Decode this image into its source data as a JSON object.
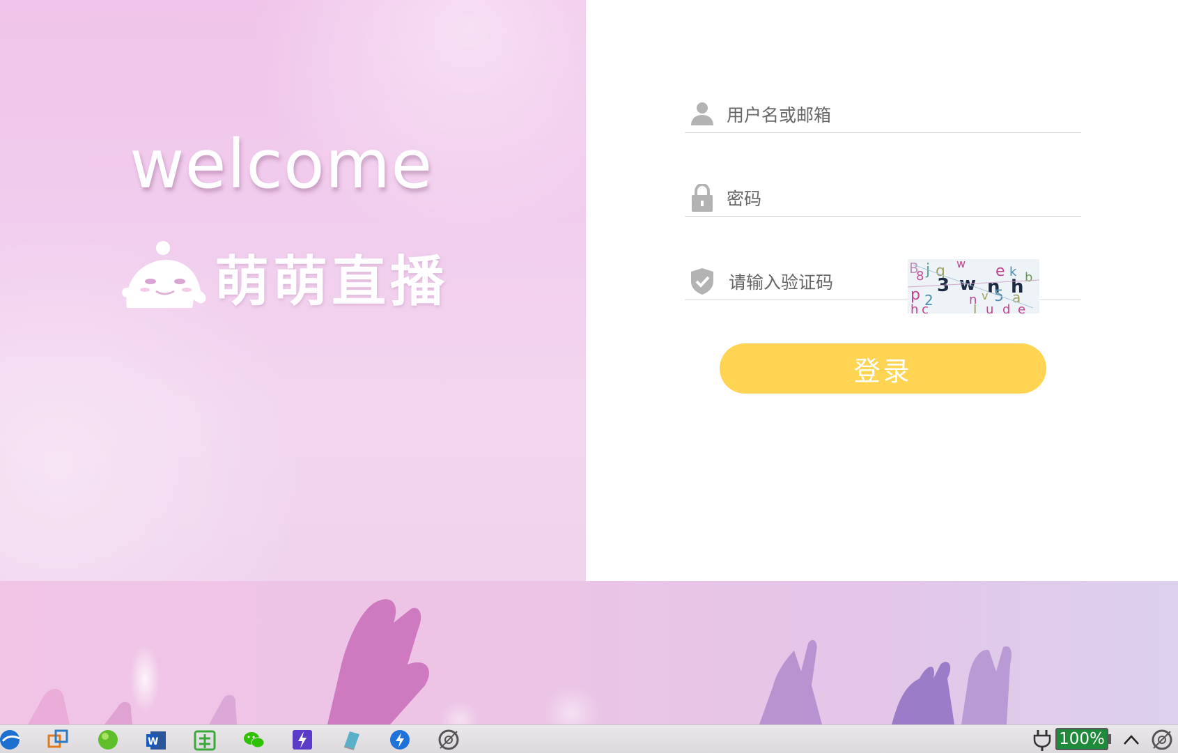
{
  "hero": {
    "welcome_text": "welcome",
    "brand_name": "萌萌直播",
    "logo_icon": "mascot-logo-icon"
  },
  "login_form": {
    "username": {
      "placeholder": "用户名或邮箱",
      "icon": "user-icon"
    },
    "password": {
      "placeholder": "密码",
      "icon": "lock-icon"
    },
    "captcha": {
      "placeholder": "请输入验证码",
      "icon": "shield-check-icon",
      "image_icon": "captcha-image"
    },
    "submit_label": "登录"
  },
  "taskbar": {
    "apps": [
      {
        "name": "browser-icon"
      },
      {
        "name": "virtual-machine-icon"
      },
      {
        "name": "green-app-icon"
      },
      {
        "name": "word-icon"
      },
      {
        "name": "chinese-ime-icon"
      },
      {
        "name": "wechat-icon"
      },
      {
        "name": "bolt-app-icon"
      },
      {
        "name": "notepad-icon"
      },
      {
        "name": "thunder-download-icon"
      },
      {
        "name": "disk-tool-icon"
      }
    ],
    "battery_level": "100%",
    "tray_expand_icon": "chevron-up-icon"
  },
  "colors": {
    "accent_button": "#ffd452",
    "hero_bg": "#f1c8ec",
    "battery_green": "#1f8a3a"
  }
}
